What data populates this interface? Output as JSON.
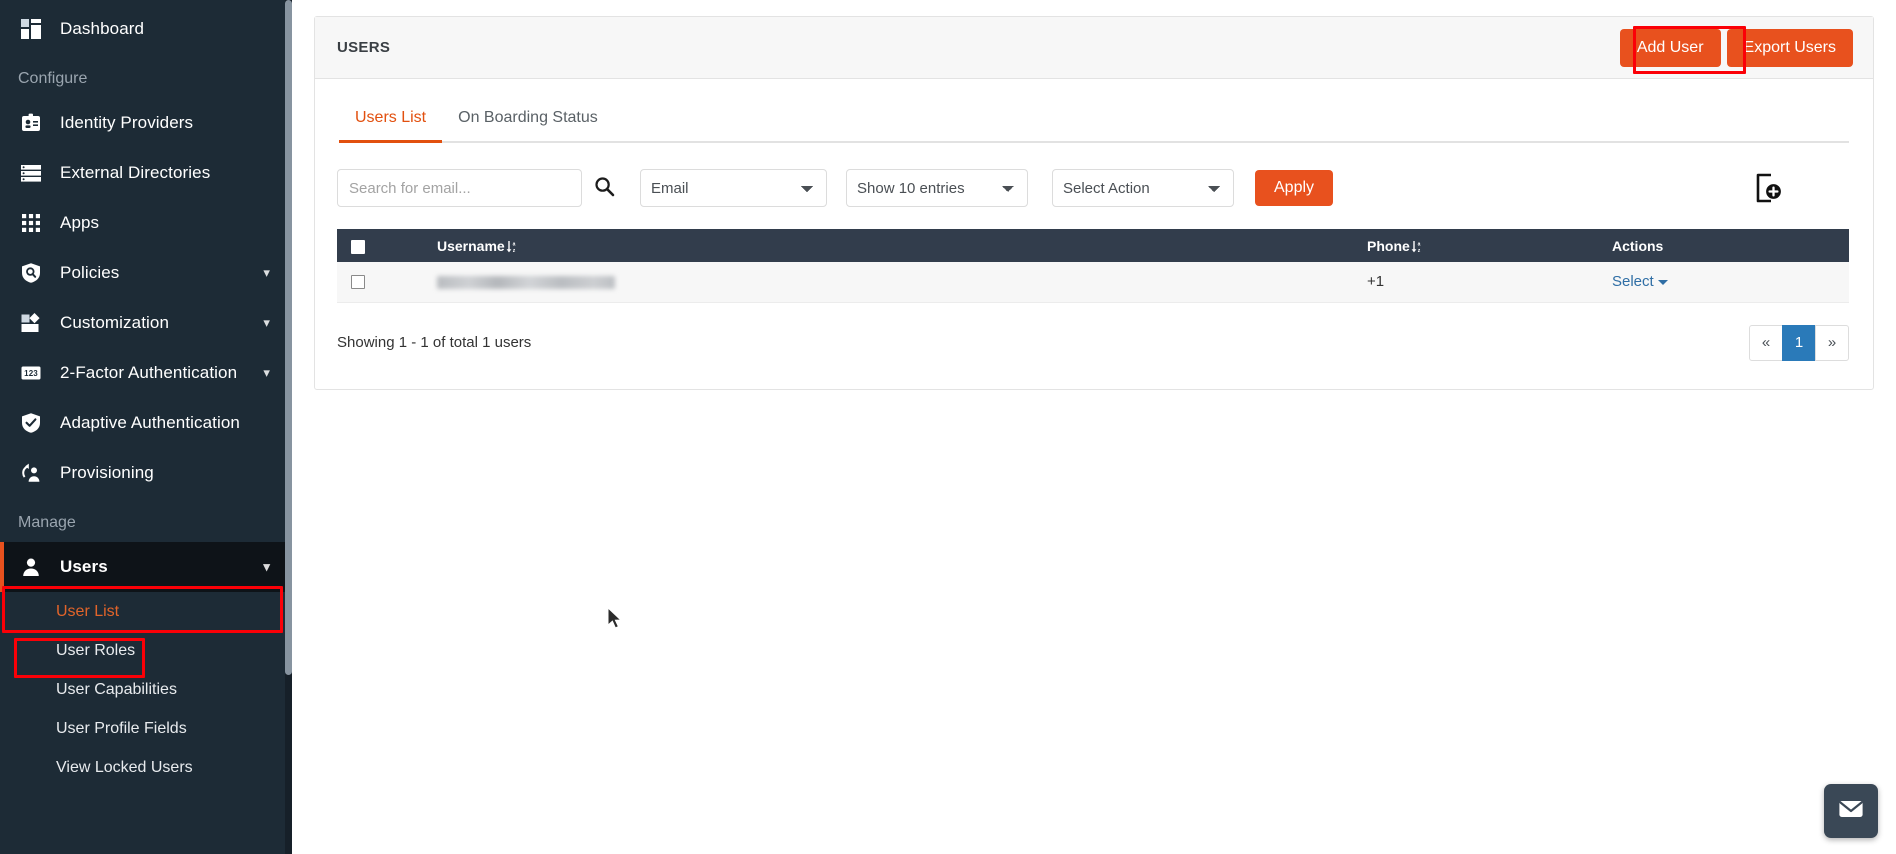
{
  "sidebar": {
    "top_items": [
      {
        "label": "Dashboard",
        "icon": "dashboard-icon",
        "expandable": false
      }
    ],
    "sections": [
      {
        "title": "Configure",
        "items": [
          {
            "label": "Identity Providers",
            "icon": "id-card-icon",
            "expandable": false
          },
          {
            "label": "External Directories",
            "icon": "server-list-icon",
            "expandable": false
          },
          {
            "label": "Apps",
            "icon": "grid-apps-icon",
            "expandable": false
          },
          {
            "label": "Policies",
            "icon": "shield-search-icon",
            "expandable": true
          },
          {
            "label": "Customization",
            "icon": "puzzle-icon",
            "expandable": true
          },
          {
            "label": "2-Factor Authentication",
            "icon": "numeric-123-icon",
            "expandable": true
          },
          {
            "label": "Adaptive Authentication",
            "icon": "shield-check-icon",
            "expandable": false
          },
          {
            "label": "Provisioning",
            "icon": "sync-user-icon",
            "expandable": false
          }
        ]
      },
      {
        "title": "Manage",
        "items": [
          {
            "label": "Users",
            "icon": "person-icon",
            "expandable": true,
            "active": true
          }
        ]
      }
    ],
    "sub_items": [
      {
        "label": "User List",
        "current": true
      },
      {
        "label": "User Roles",
        "current": false
      },
      {
        "label": "User Capabilities",
        "current": false
      },
      {
        "label": "User Profile Fields",
        "current": false
      },
      {
        "label": "View Locked Users",
        "current": false
      }
    ]
  },
  "card": {
    "title": "USERS",
    "add_user_label": "Add User",
    "export_users_label": "Export Users"
  },
  "tabs": [
    {
      "label": "Users List",
      "active": true
    },
    {
      "label": "On Boarding Status",
      "active": false
    }
  ],
  "toolbar": {
    "search_placeholder": "Search for email...",
    "search_value": "",
    "search_icon": "search-icon",
    "field_select_value": "Email",
    "entries_select_value": "Show 10 entries",
    "action_select_value": "Select Action",
    "apply_label": "Apply",
    "bulk_upload_icon": "file-add-icon"
  },
  "table": {
    "columns": [
      {
        "key": "check",
        "label": "",
        "sortable": false
      },
      {
        "key": "username",
        "label": "Username",
        "sortable": true
      },
      {
        "key": "phone",
        "label": "Phone",
        "sortable": true
      },
      {
        "key": "actions",
        "label": "Actions",
        "sortable": false
      }
    ],
    "rows": [
      {
        "checked": false,
        "username": "",
        "username_redacted": true,
        "phone": "+1",
        "action_label": "Select"
      }
    ]
  },
  "footer": {
    "showing_text": "Showing 1 - 1 of total 1 users",
    "pagination": {
      "prev_label": "«",
      "next_label": "»",
      "pages": [
        "1"
      ],
      "current_page": "1"
    }
  },
  "colors": {
    "accent_orange": "#e8511e",
    "sidebar_bg": "#1d2b36",
    "table_header_bg": "#323d4c",
    "annotation_red": "#fb0007",
    "pagination_active": "#2a7ab9"
  },
  "chat_widget": {
    "icon": "envelope-icon"
  }
}
